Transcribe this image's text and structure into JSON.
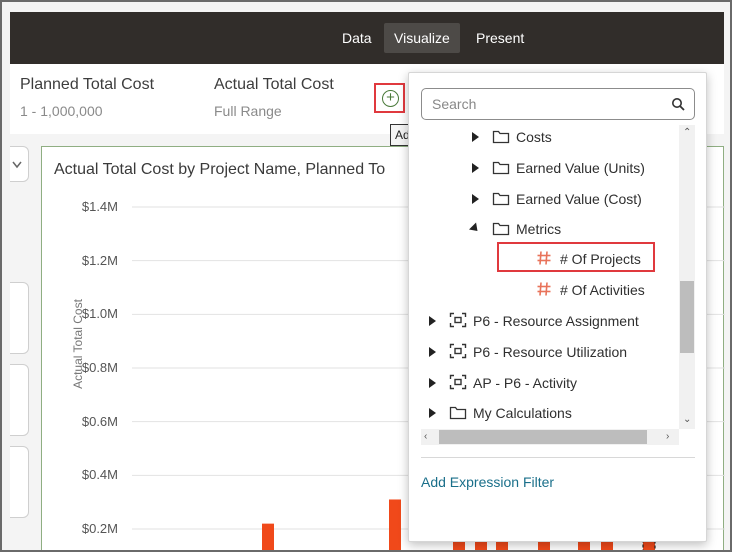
{
  "nav": {
    "tabs": [
      {
        "label": "Data",
        "active": false
      },
      {
        "label": "Visualize",
        "active": true
      },
      {
        "label": "Present",
        "active": false
      }
    ]
  },
  "filters": [
    {
      "label": "Planned Total Cost",
      "value": "1 - 1,000,000"
    },
    {
      "label": "Actual Total Cost",
      "value": "Full Range"
    }
  ],
  "add_filter": {
    "tooltip": "Add Filter"
  },
  "chart": {
    "title": "Actual Total Cost by Project Name, Planned To",
    "ylabel": "Actual Total Cost"
  },
  "chart_data": {
    "type": "bar",
    "title": "Actual Total Cost by Project Name, Planned To",
    "ylabel": "Actual Total Cost",
    "ytick_labels": [
      "$1.4M",
      "$1.2M",
      "$1.0M",
      "$0.8M",
      "$0.6M",
      "$0.4M",
      "$0.2M"
    ],
    "yticks": [
      1.4,
      1.2,
      1.0,
      0.8,
      0.6,
      0.4,
      0.2
    ],
    "ylim": [
      0.13,
      1.5
    ],
    "bar_color": "#f0491a",
    "values": [
      0.22,
      0.31,
      0.29,
      0.18,
      0.21,
      0.29,
      0.19,
      0.29,
      0.28
    ]
  },
  "dropdown": {
    "search_placeholder": "Search",
    "items": [
      {
        "label": "Costs",
        "icon": "folder-icon",
        "expander": "right",
        "indent": 1
      },
      {
        "label": "Earned Value (Units)",
        "icon": "folder-icon",
        "expander": "right",
        "indent": 1
      },
      {
        "label": "Earned Value (Cost)",
        "icon": "folder-icon",
        "expander": "right",
        "indent": 1
      },
      {
        "label": "Metrics",
        "icon": "folder-icon",
        "expander": "down",
        "indent": 1
      },
      {
        "label": "# Of Projects",
        "icon": "hash-icon",
        "expander": "none",
        "indent": 2,
        "highlighted": true
      },
      {
        "label": "# Of Activities",
        "icon": "hash-icon",
        "expander": "none",
        "indent": 2
      },
      {
        "label": "P6 - Resource Assignment",
        "icon": "subject-area-icon",
        "expander": "right",
        "indent": 0
      },
      {
        "label": "P6 - Resource Utilization",
        "icon": "subject-area-icon",
        "expander": "right",
        "indent": 0
      },
      {
        "label": "AP - P6 - Activity",
        "icon": "subject-area-icon",
        "expander": "right",
        "indent": 0
      },
      {
        "label": "My Calculations",
        "icon": "folder-icon",
        "expander": "right",
        "indent": 0
      }
    ],
    "expression_filter_link": "Add Expression Filter"
  },
  "colors": {
    "topbar": "#312d2a",
    "highlight": "#e0393e",
    "hash_icon": "#e8735a",
    "link": "#1a6f8a"
  }
}
